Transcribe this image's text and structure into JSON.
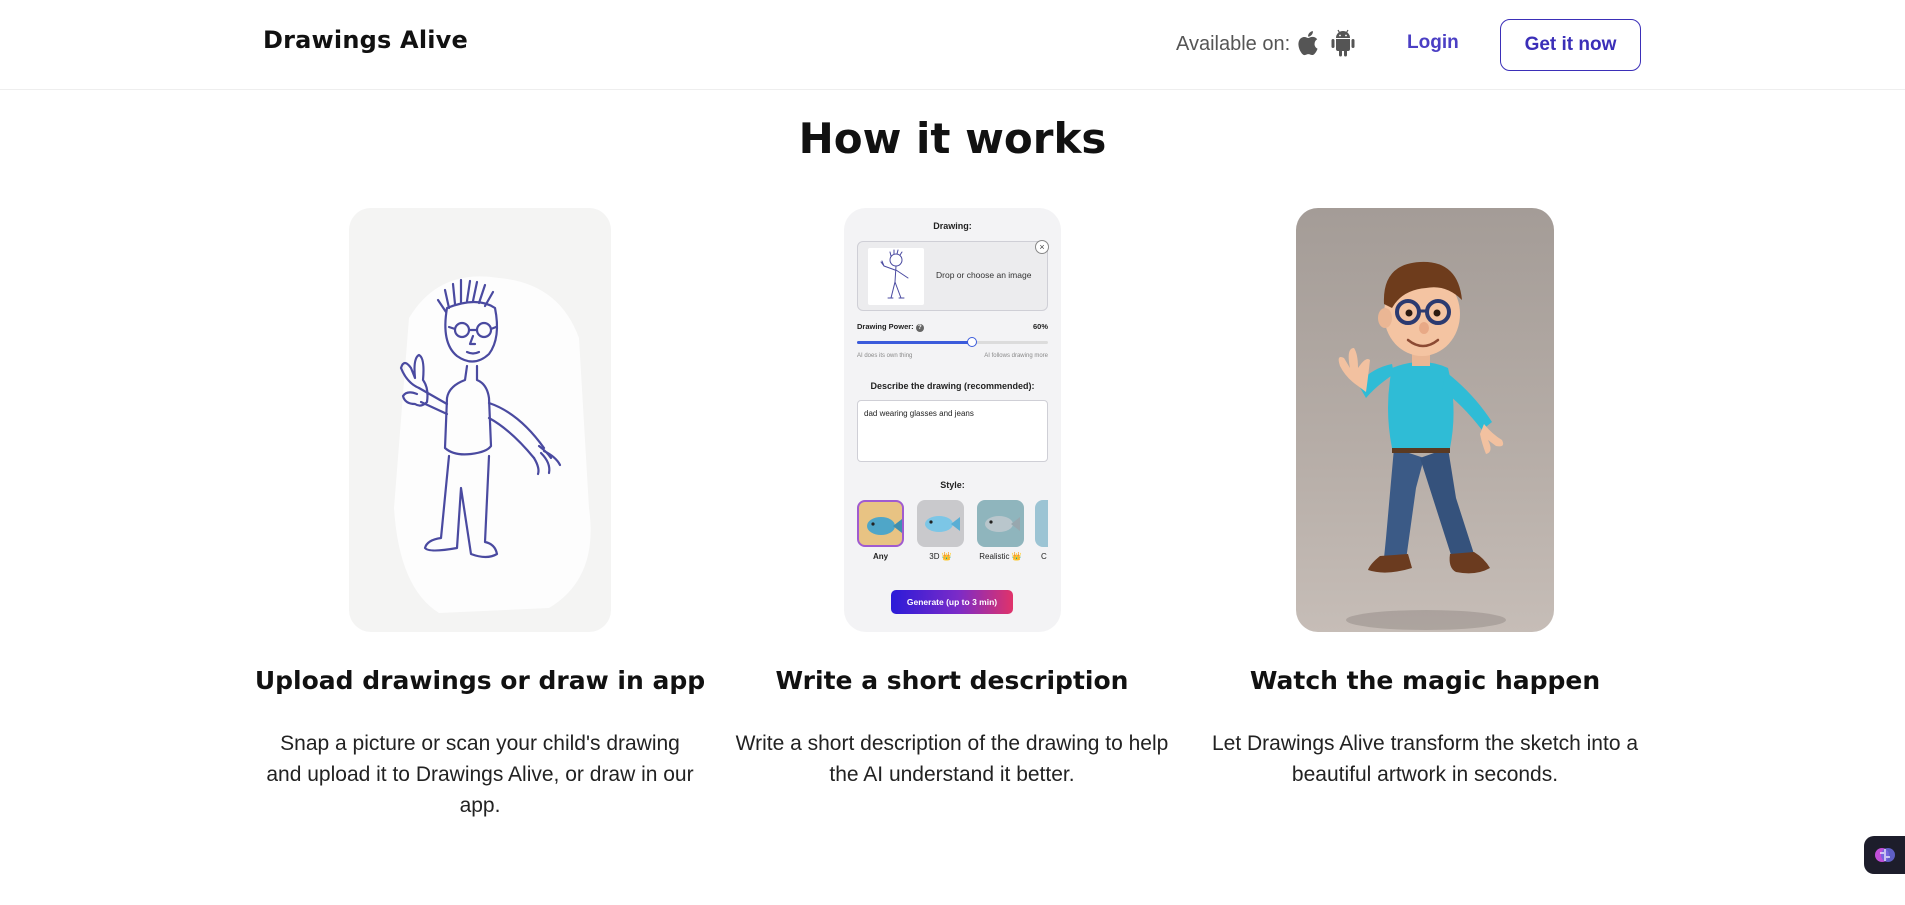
{
  "header": {
    "logo": "Drawings Alive",
    "available_label": "Available on:",
    "platforms": [
      "apple-icon",
      "android-icon"
    ],
    "login": "Login",
    "cta": "Get it now",
    "accent_color": "#3b2fb8"
  },
  "section": {
    "title": "How it works",
    "steps": [
      {
        "title": "Upload drawings or draw in app",
        "description": "Snap a picture or scan your child's drawing and upload it to Drawings Alive, or draw in our app."
      },
      {
        "title": "Write a short description",
        "description": "Write a short description of the drawing to help the AI understand it better."
      },
      {
        "title": "Watch the magic happen",
        "description": "Let Drawings Alive transform the sketch into a beautiful artwork in seconds."
      }
    ]
  },
  "mockup": {
    "drawing_label": "Drawing:",
    "drop_text": "Drop or choose an image",
    "power_label": "Drawing Power:",
    "power_value": "60%",
    "power_fraction": 0.6,
    "hint_left": "AI does its own thing",
    "hint_right": "AI follows drawing more",
    "describe_label": "Describe the drawing (recommended):",
    "describe_value": "dad wearing glasses and jeans",
    "style_label": "Style:",
    "styles": [
      "Any",
      "3D 👑",
      "Realistic 👑",
      "C"
    ],
    "generate_label": "Generate (up to 3 min)"
  }
}
